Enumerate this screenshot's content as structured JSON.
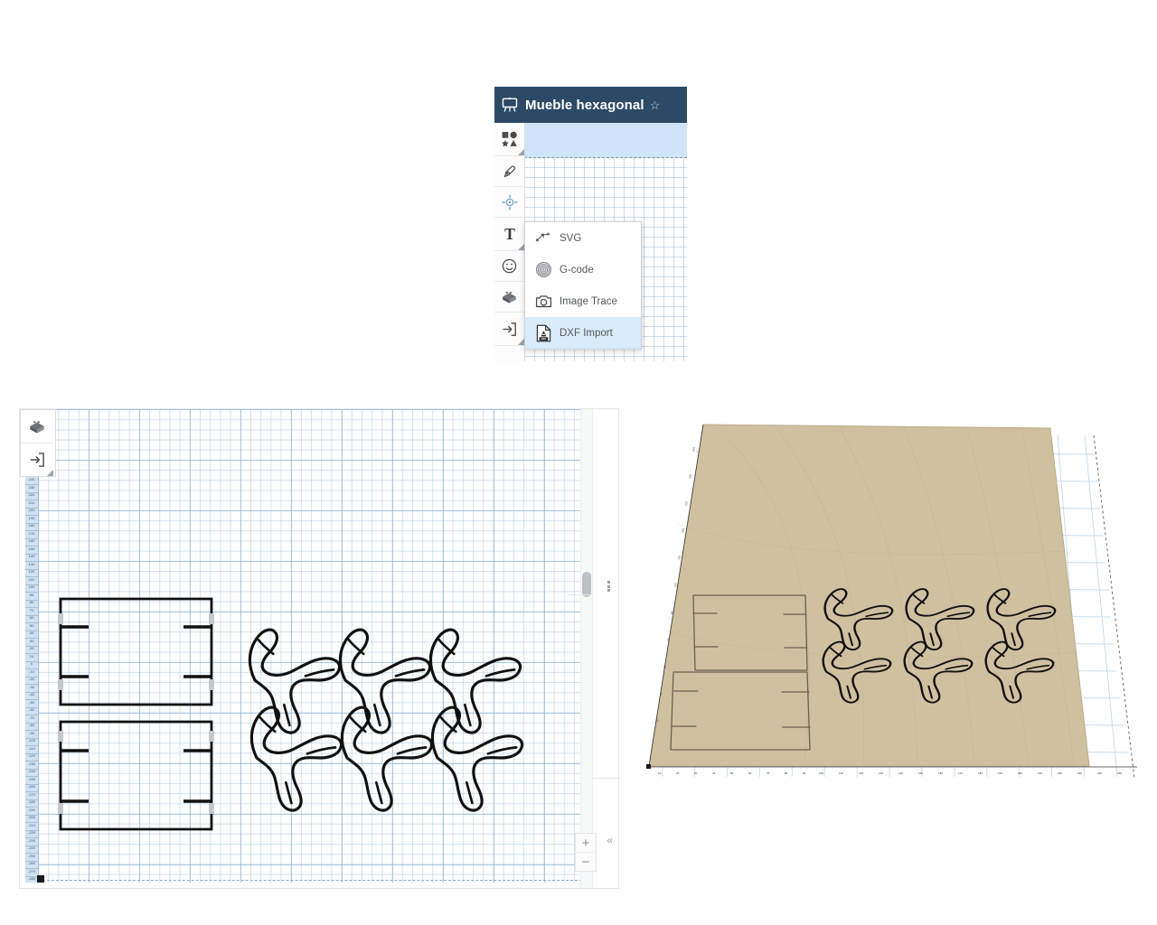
{
  "app": {
    "header": {
      "logo_icon": "easel-project-icon",
      "project_title": "Mueble hexagonal",
      "favorite_icon": "star-icon",
      "header_bg": "#2c4a66"
    },
    "selection_band_color": "#cfe4f7"
  },
  "toolbar": {
    "items": [
      {
        "name": "shapes-tool",
        "icon": "shapes-icon",
        "label": "Shapes",
        "has_submenu": true,
        "selected": false
      },
      {
        "name": "pen-tool",
        "icon": "pen-nib-icon",
        "label": "Pen",
        "has_submenu": false,
        "selected": false
      },
      {
        "name": "drill-tool",
        "icon": "target-icon",
        "label": "Drill",
        "has_submenu": false,
        "selected": true
      },
      {
        "name": "text-tool",
        "icon": "text-t-icon",
        "label": "Text",
        "has_submenu": true,
        "selected": false
      },
      {
        "name": "apps-tool",
        "icon": "smiley-icon",
        "label": "Apps",
        "has_submenu": false,
        "selected": false
      },
      {
        "name": "objects-tool",
        "icon": "brick-icon",
        "label": "Objects",
        "has_submenu": false,
        "selected": false
      },
      {
        "name": "import-tool",
        "icon": "import-arrow-icon",
        "label": "Import",
        "has_submenu": true,
        "selected": false
      }
    ]
  },
  "import_menu": {
    "items": [
      {
        "label": "SVG",
        "icon": "svg-path-icon",
        "active": false
      },
      {
        "label": "G-code",
        "icon": "spiral-icon",
        "active": false
      },
      {
        "label": "Image Trace",
        "icon": "camera-icon",
        "active": false
      },
      {
        "label": "DXF Import",
        "icon": "dxf-file-icon",
        "active": true
      }
    ],
    "highlight_color": "#d9eaf8"
  },
  "canvas": {
    "tools": [
      {
        "name": "objects-tool",
        "icon": "brick-icon",
        "has_submenu": false
      },
      {
        "name": "import-tool",
        "icon": "import-arrow-icon",
        "has_submenu": true
      }
    ],
    "zoom_controls": {
      "zoom_in": "+",
      "zoom_out": "−"
    },
    "collapse_icon": "chevron-double-left-icon",
    "vertical_ruler_ticks": [
      "240",
      "230",
      "220",
      "210",
      "200",
      "190",
      "180",
      "170",
      "160",
      "150",
      "140",
      "130",
      "120",
      "110",
      "100",
      "90",
      "80",
      "70",
      "60",
      "50",
      "40",
      "30",
      "20",
      "10",
      "0",
      "-10",
      "-20",
      "-30",
      "-40",
      "-50",
      "-60",
      "-70",
      "-80",
      "-90",
      "-100",
      "-110",
      "-120",
      "-130",
      "-140",
      "-150",
      "-160",
      "-170",
      "-180",
      "-190",
      "-200",
      "-210",
      "-220",
      "-230",
      "-240",
      "-250",
      "-260",
      "-270",
      "-280"
    ],
    "grid_color": "#96b9d4",
    "origin_marker": "origin-square"
  },
  "preview": {
    "material_color": "#cfc1a0",
    "material_edge_color": "#b9aa88",
    "grid_color": "#9fc0dc",
    "ruler_label_color": "#3a3a3a"
  }
}
